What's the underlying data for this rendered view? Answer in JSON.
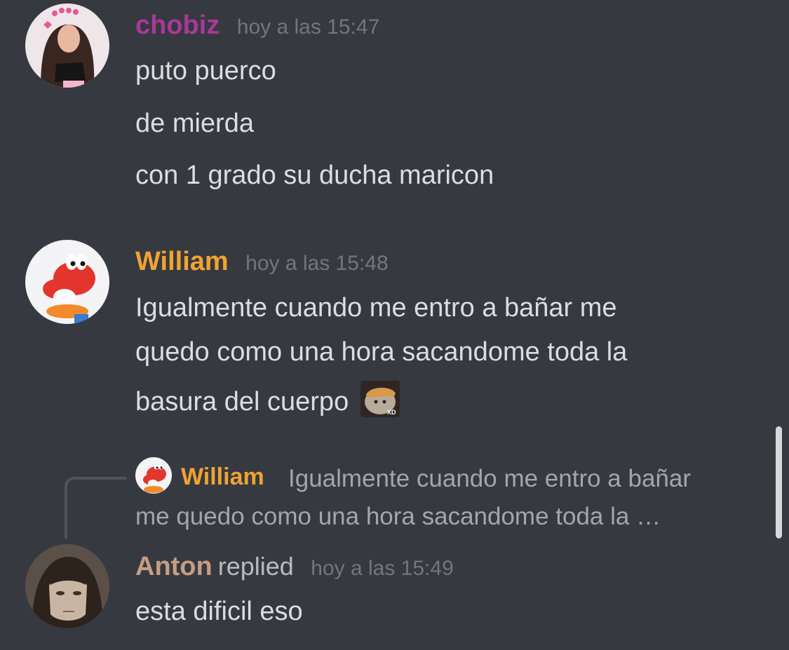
{
  "messages": [
    {
      "author": "chobiz",
      "author_color": "#a7399a",
      "timestamp": "hoy a las 15:47",
      "lines": [
        "puto puerco",
        "de mierda",
        "con 1 grado su ducha maricon"
      ]
    },
    {
      "author": "William",
      "author_color": "#f0a332",
      "timestamp": "hoy a las 15:48",
      "lines": [
        "Igualmente cuando me entro a bañar me",
        "quedo como una hora sacandome toda la",
        "basura del cuerpo"
      ],
      "emoji_label": "XD"
    },
    {
      "author": "Anton",
      "author_color": "#c69c85",
      "replied_label": "replied",
      "timestamp": "hoy a las 15:49",
      "lines": [
        "esta dificil eso"
      ],
      "reply_to": {
        "author": "William",
        "preview_lines": [
          "Igualmente cuando me entro a bañar",
          "me quedo como una hora sacandome toda la …"
        ]
      }
    }
  ]
}
